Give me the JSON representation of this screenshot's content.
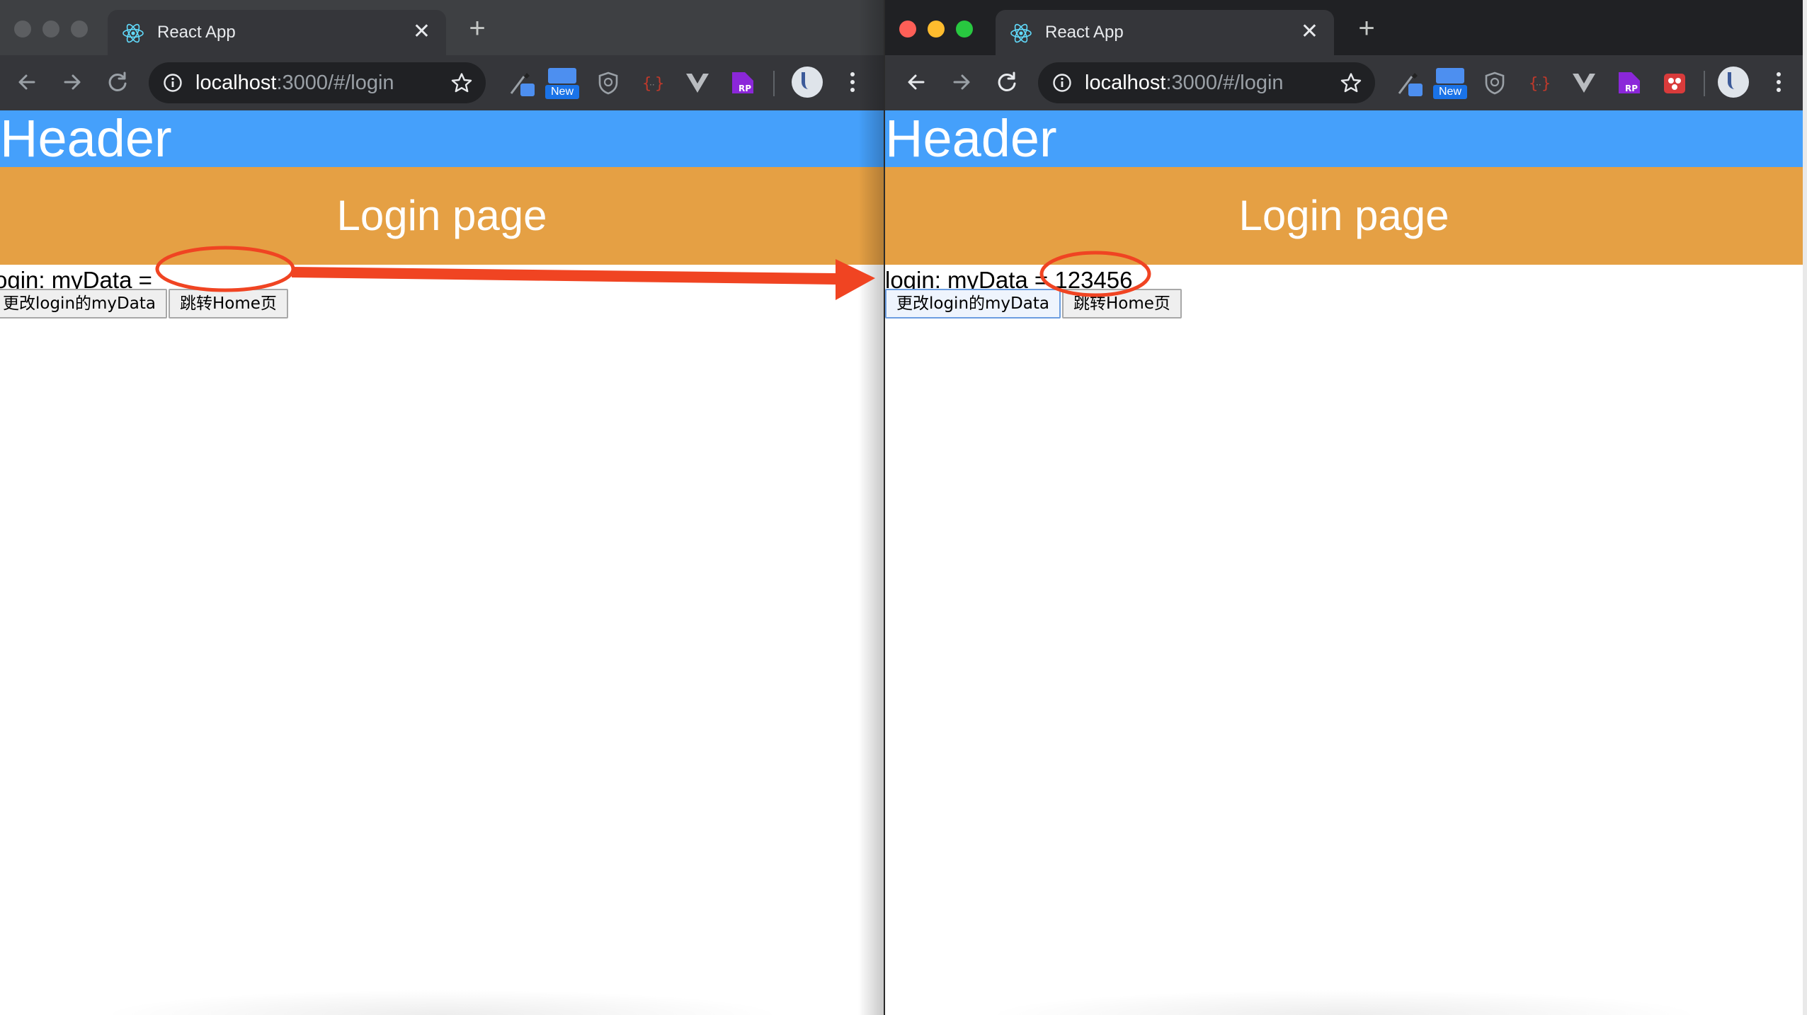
{
  "left_window": {
    "tab": {
      "title": "React App"
    },
    "address_bar": {
      "host": "localhost",
      "path": ":3000/#/login"
    },
    "extensions": {
      "new_badge": "New"
    },
    "page": {
      "header": "Header",
      "banner": "Login page",
      "data_line": "ogin: myData =",
      "buttons": {
        "change": "更改login的myData",
        "go_home": "跳转Home页"
      }
    }
  },
  "right_window": {
    "tab": {
      "title": "React App"
    },
    "address_bar": {
      "host": "localhost",
      "path": ":3000/#/login"
    },
    "extensions": {
      "new_badge": "New"
    },
    "page": {
      "header": "Header",
      "banner": "Login page",
      "data_line": "login: myData = 123456",
      "buttons": {
        "change": "更改login的myData",
        "go_home": "跳转Home页"
      }
    }
  },
  "colors": {
    "app_header_bg": "#45a0fb",
    "login_banner_bg": "#e5a044",
    "annotation_red": "#f04422",
    "traffic_red": "#fe5f57",
    "traffic_yellow": "#febc2e",
    "traffic_green": "#28c840"
  },
  "icons": [
    "react-logo-icon",
    "close-icon",
    "plus-icon",
    "back-arrow-icon",
    "forward-arrow-icon",
    "reload-icon",
    "info-icon",
    "star-icon",
    "pen-extension-icon",
    "new-extension-icon",
    "shield-extension-icon",
    "braces-extension-icon",
    "vue-extension-icon",
    "rp-extension-icon",
    "gift-extension-icon",
    "avatar-icon",
    "more-menu-icon"
  ]
}
